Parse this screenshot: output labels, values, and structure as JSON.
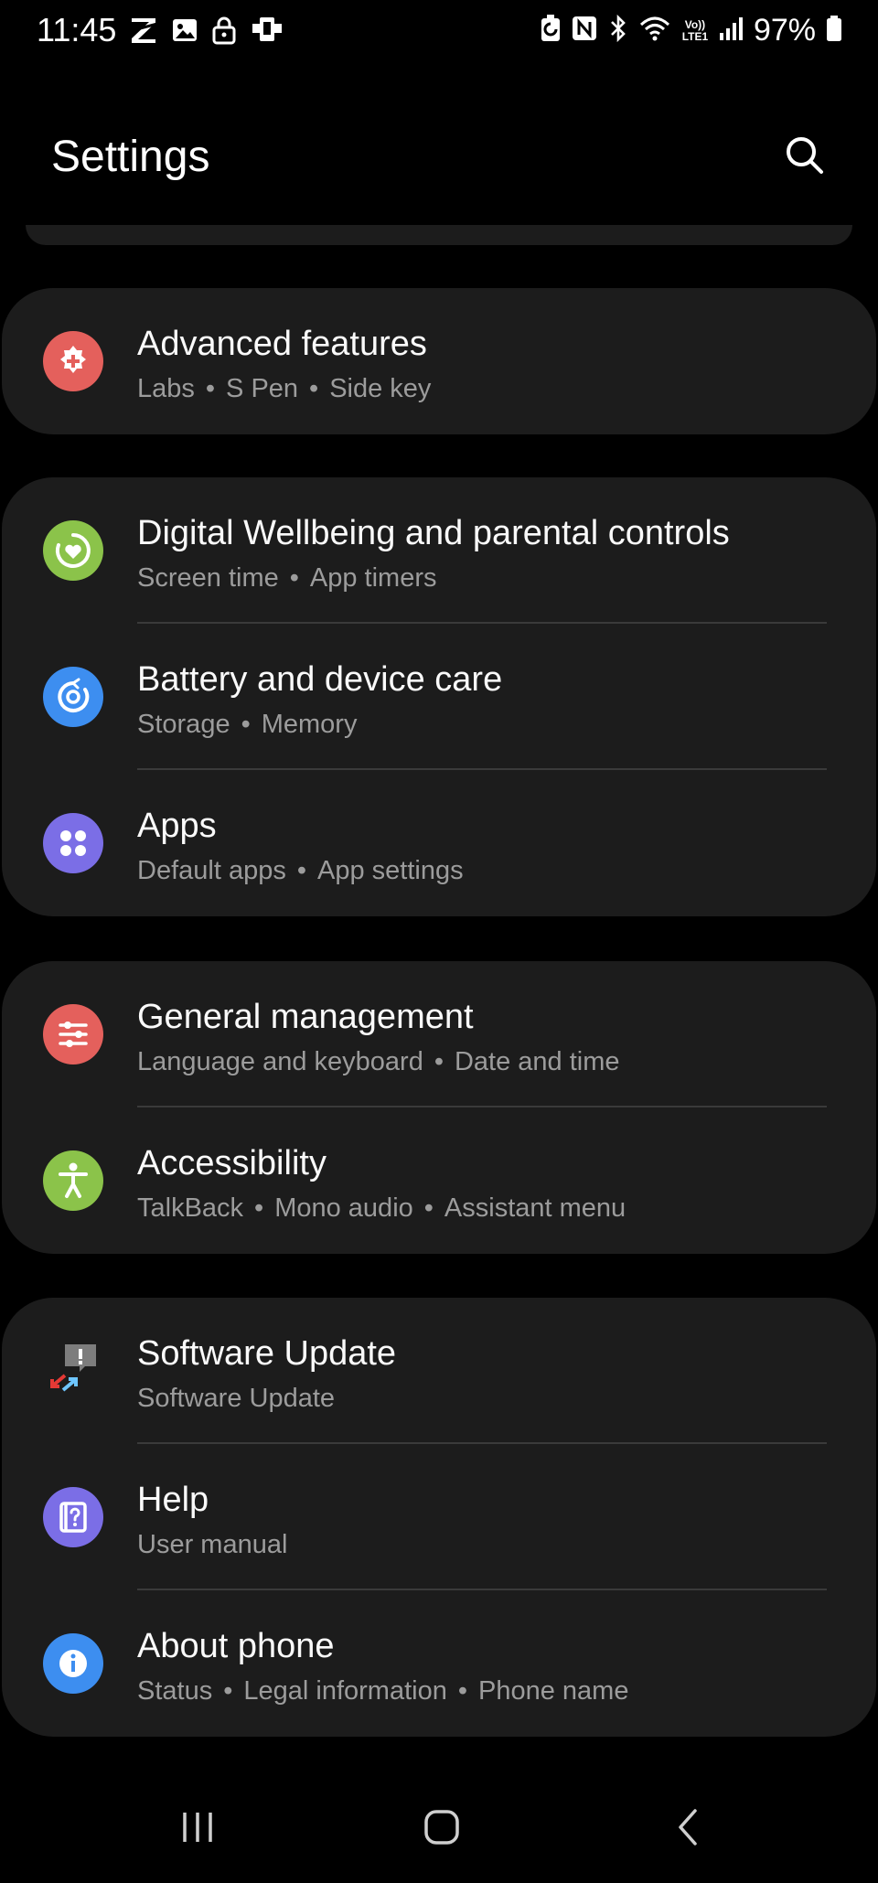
{
  "status_bar": {
    "time": "11:45",
    "battery_text": "97%",
    "left_icons": [
      "z-icon",
      "gallery-icon",
      "lock-icon",
      "sync-icon"
    ],
    "right_icons": [
      "battery-saver-icon",
      "nfc-icon",
      "bluetooth-icon",
      "wifi-icon",
      "volte-icon",
      "signal-icon",
      "battery-icon"
    ],
    "volte_label": "Vo)) LTE1"
  },
  "header": {
    "title": "Settings"
  },
  "groups": [
    {
      "items": [
        {
          "title": "Advanced features",
          "subs": [
            "Labs",
            "S Pen",
            "Side key"
          ],
          "icon": "advanced-features-icon",
          "color": "#e4605c"
        }
      ]
    },
    {
      "items": [
        {
          "title": "Digital Wellbeing and parental controls",
          "subs": [
            "Screen time",
            "App timers"
          ],
          "icon": "digital-wellbeing-icon",
          "color": "#8bc34a"
        },
        {
          "title": "Battery and device care",
          "subs": [
            "Storage",
            "Memory"
          ],
          "icon": "device-care-icon",
          "color": "#3d8ef0"
        },
        {
          "title": "Apps",
          "subs": [
            "Default apps",
            "App settings"
          ],
          "icon": "apps-icon",
          "color": "#7b6ee6"
        }
      ]
    },
    {
      "items": [
        {
          "title": "General management",
          "subs": [
            "Language and keyboard",
            "Date and time"
          ],
          "icon": "general-management-icon",
          "color": "#e4605c"
        },
        {
          "title": "Accessibility",
          "subs": [
            "TalkBack",
            "Mono audio",
            "Assistant menu"
          ],
          "icon": "accessibility-icon",
          "color": "#8bc34a"
        }
      ]
    },
    {
      "items": [
        {
          "title": "Software Update",
          "subs": [
            "Software Update"
          ],
          "icon": "software-update-icon",
          "color": "#1c1c1c"
        },
        {
          "title": "Help",
          "subs": [
            "User manual"
          ],
          "icon": "help-icon",
          "color": "#7b6ee6"
        },
        {
          "title": "About phone",
          "subs": [
            "Status",
            "Legal information",
            "Phone name"
          ],
          "icon": "about-phone-icon",
          "color": "#3d8ef0"
        }
      ]
    }
  ],
  "nav_bar": {
    "buttons": [
      "recent-apps-icon",
      "home-icon",
      "back-icon"
    ]
  }
}
